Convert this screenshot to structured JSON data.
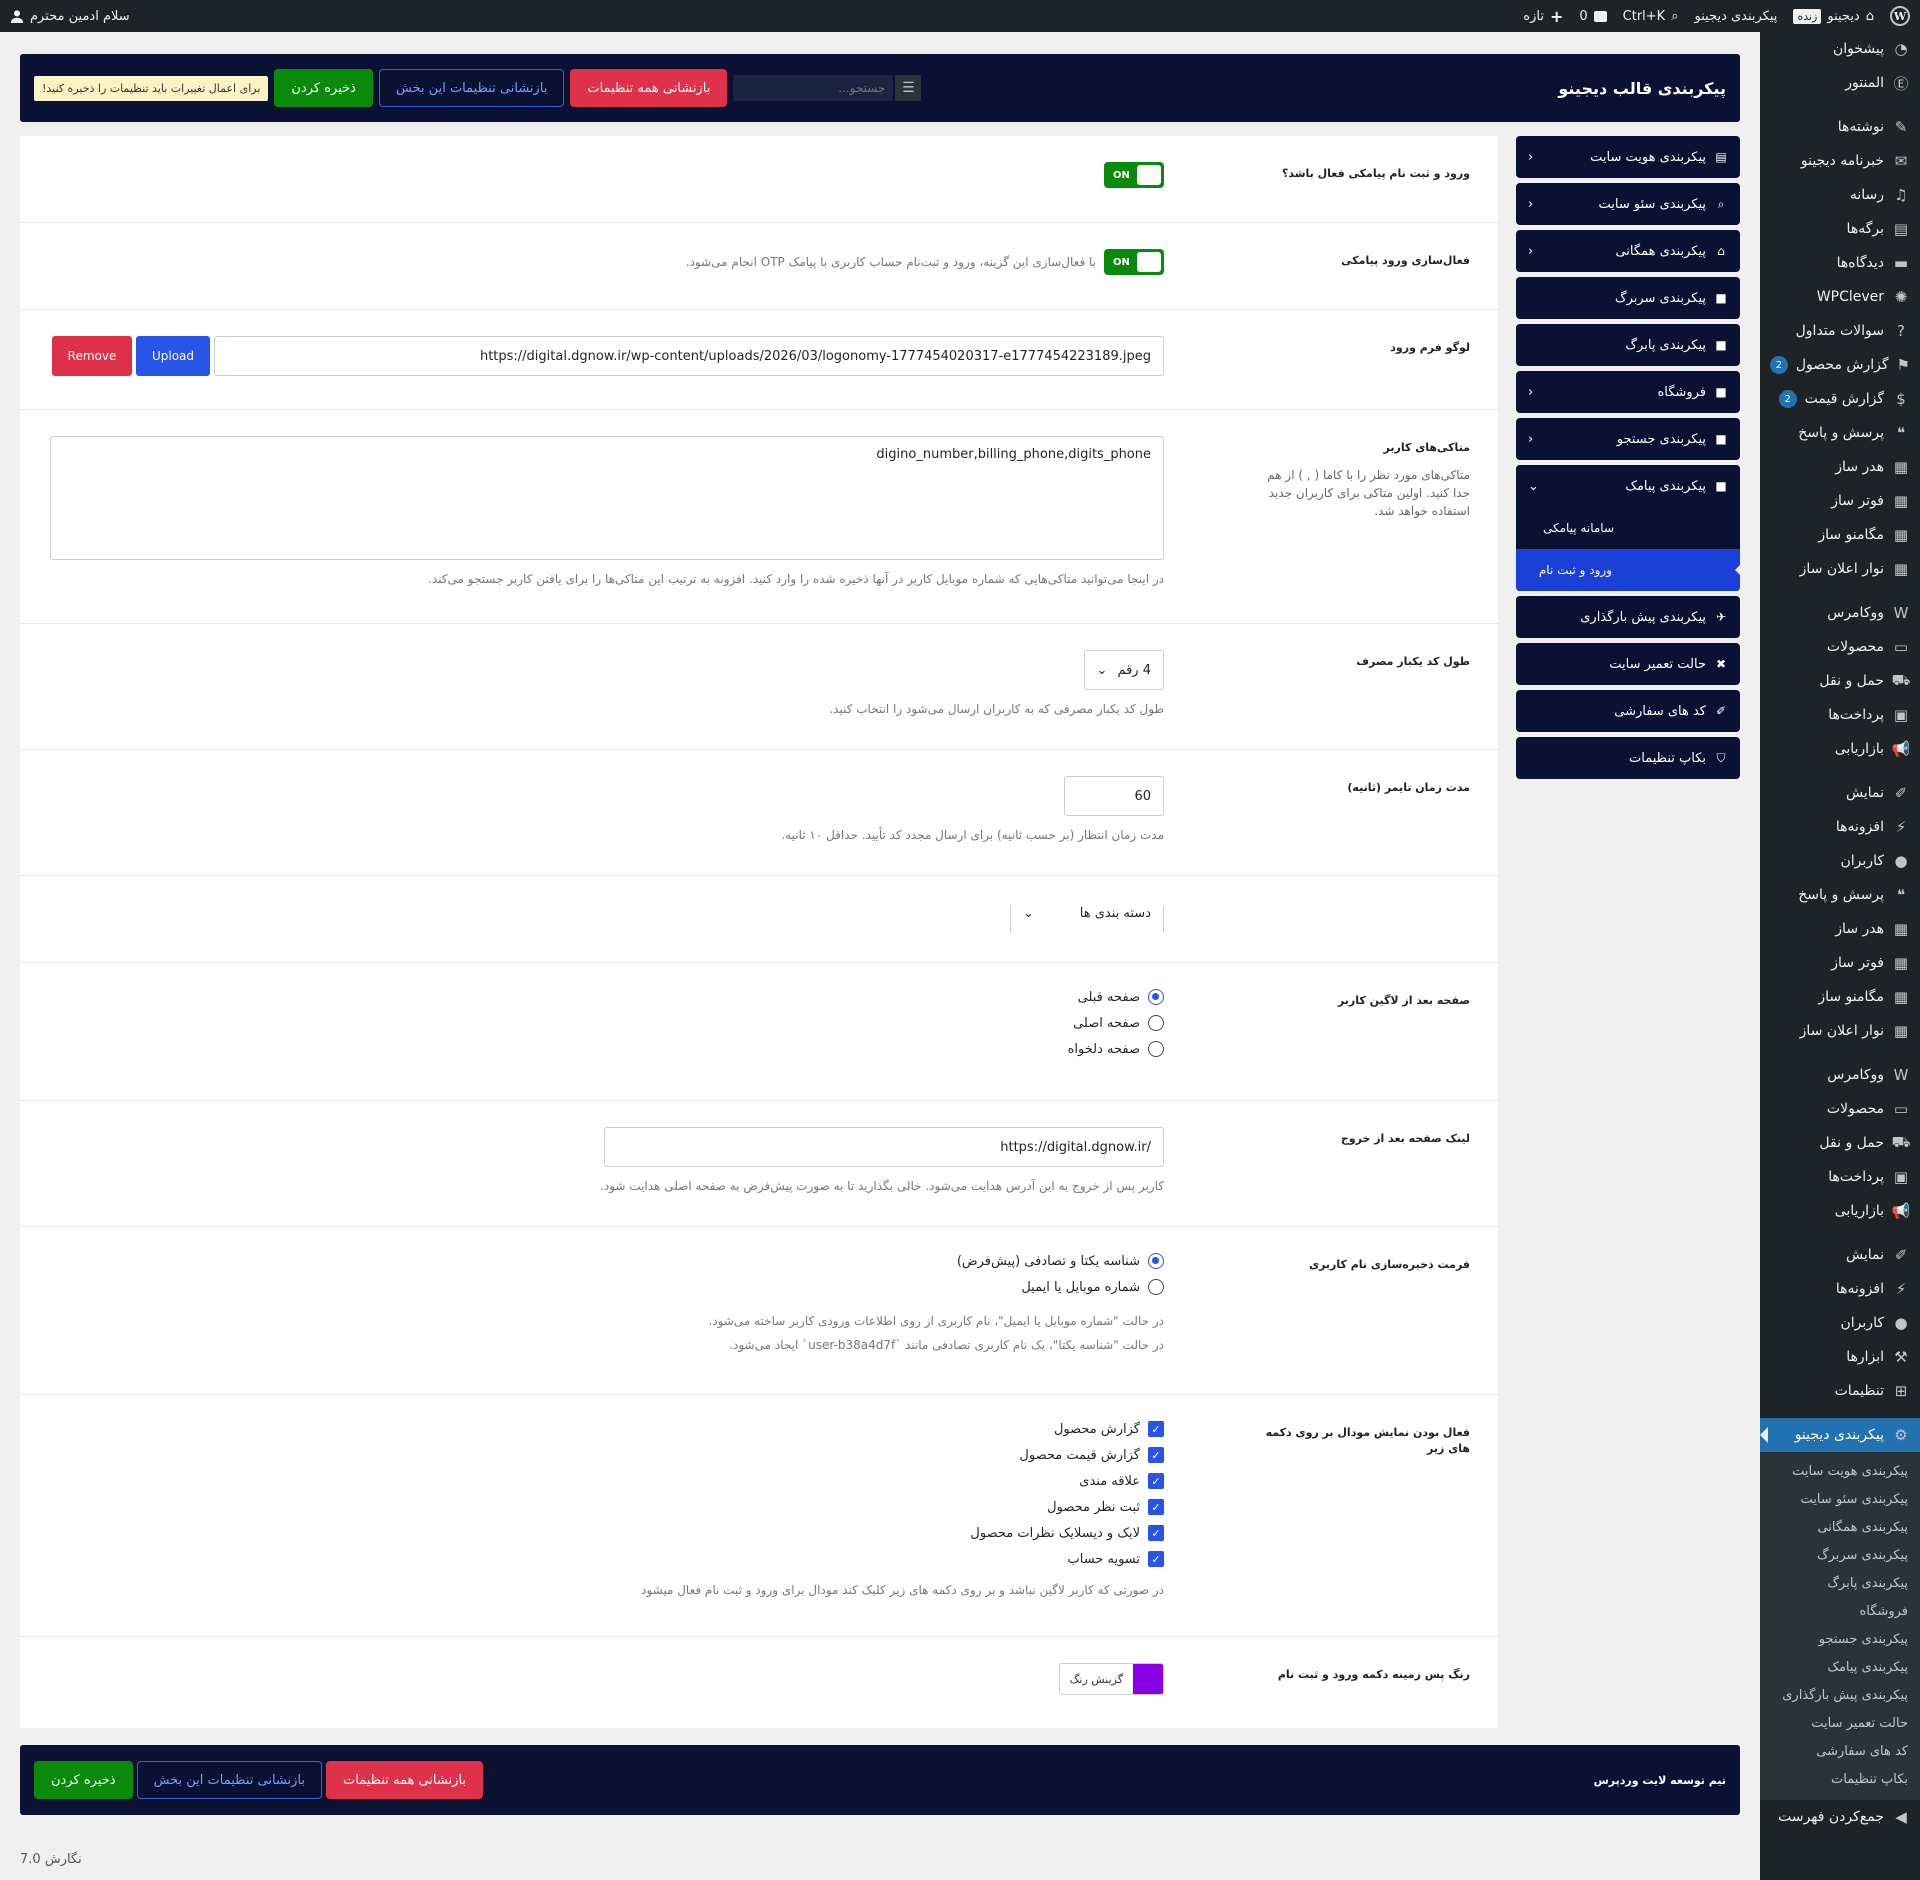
{
  "adminbar": {
    "site_name": "دیجینو",
    "live": "زنده",
    "theme_config": "پیکربندی دیجینو",
    "shortcut": "Ctrl+K",
    "comments_count": "0",
    "new_label": "تازه",
    "greeting": "سلام ادمین محترم"
  },
  "menu": {
    "items": [
      {
        "label": "پیشخوان",
        "icon": "dashboard-icon"
      },
      {
        "label": "المنتور",
        "icon": "elementor-icon"
      },
      {
        "label": "نوشته‌ها",
        "icon": "pin-icon"
      },
      {
        "label": "خبرنامه دیجینو",
        "icon": "mail-icon"
      },
      {
        "label": "رسانه",
        "icon": "media-icon"
      },
      {
        "label": "برگه‌ها",
        "icon": "pages-icon"
      },
      {
        "label": "دیدگاه‌ها",
        "icon": "comment-icon"
      },
      {
        "label": "WPClever",
        "icon": "bulb-icon"
      },
      {
        "label": "سوالات متداول",
        "icon": "help-icon"
      },
      {
        "label": "گزارش محصول",
        "icon": "flag-icon",
        "count": "2"
      },
      {
        "label": "گزارش قیمت",
        "icon": "dollar-icon",
        "count": "2"
      },
      {
        "label": "پرسش و پاسخ",
        "icon": "chat-icon"
      },
      {
        "label": "هدر ساز",
        "icon": "grid-icon"
      },
      {
        "label": "فوتر ساز",
        "icon": "grid-icon"
      },
      {
        "label": "مگامنو ساز",
        "icon": "grid-icon"
      },
      {
        "label": "نوار اعلان ساز",
        "icon": "grid-icon"
      },
      {
        "label": "ووکامرس",
        "icon": "woo-icon"
      },
      {
        "label": "محصولات",
        "icon": "archive-icon"
      },
      {
        "label": "حمل و نقل",
        "icon": "truck-icon"
      },
      {
        "label": "پرداخت‌ها",
        "icon": "payment-icon"
      },
      {
        "label": "بازاریابی",
        "icon": "megaphone-icon"
      },
      {
        "label": "نمایش",
        "icon": "brush-icon"
      },
      {
        "label": "افزونه‌ها",
        "icon": "plugin-icon"
      },
      {
        "label": "کاربران",
        "icon": "user-icon"
      },
      {
        "label": "پرسش و پاسخ",
        "icon": "chat-icon"
      },
      {
        "label": "هدر ساز",
        "icon": "grid-icon"
      },
      {
        "label": "فوتر ساز",
        "icon": "grid-icon"
      },
      {
        "label": "مگامنو ساز",
        "icon": "grid-icon"
      },
      {
        "label": "نوار اعلان ساز",
        "icon": "grid-icon"
      },
      {
        "label": "ووکامرس",
        "icon": "woo-icon"
      },
      {
        "label": "محصولات",
        "icon": "archive-icon"
      },
      {
        "label": "حمل و نقل",
        "icon": "truck-icon"
      },
      {
        "label": "پرداخت‌ها",
        "icon": "payment-icon"
      },
      {
        "label": "بازاریابی",
        "icon": "megaphone-icon"
      },
      {
        "label": "نمایش",
        "icon": "brush-icon"
      },
      {
        "label": "افزونه‌ها",
        "icon": "plugin-icon"
      },
      {
        "label": "کاربران",
        "icon": "user-icon"
      },
      {
        "label": "ابزارها",
        "icon": "wrench-icon"
      },
      {
        "label": "تنظیمات",
        "icon": "settings-icon"
      }
    ],
    "active": {
      "label": "پیکربندی دیجینو",
      "icon": "gear-icon"
    },
    "submenu": [
      "پیکربندی هویت سایت",
      "پیکربندی سئو سایت",
      "پیکربندی همگانی",
      "پیکربندی سربرگ",
      "پیکربندی پابرگ",
      "فروشگاه",
      "پیکربندی جستجو",
      "پیکربندی پیامک",
      "پیکربندی پیش بارگذاری",
      "حالت تعمیر سایت",
      "کد های سفارشی",
      "بکاپ تنظیمات"
    ],
    "collapse": "جمع‌کردن فهرست"
  },
  "topbar": {
    "title": "پیکربندی قالب دیجینو",
    "search_placeholder": "جستجو...",
    "reset_all": "بازنشانی همه تنظیمات",
    "reset_section": "بازنشانی تنظیمات این بخش",
    "save": "ذخیره کردن",
    "notice": "برای اعمال تغییرات باید تنظیمات را ذخیره کنید!"
  },
  "sidenav": {
    "items": [
      {
        "label": "پیکربندی هویت سایت",
        "icon": "id-card-icon",
        "chevron": true
      },
      {
        "label": "پیکربندی سئو سایت",
        "icon": "search-icon",
        "chevron": true
      },
      {
        "label": "پیکربندی همگانی",
        "icon": "home-icon",
        "chevron": true
      },
      {
        "label": "پیکربندی سربرگ",
        "icon": "lock-icon",
        "chevron": false
      },
      {
        "label": "پیکربندی پابرگ",
        "icon": "lock-icon",
        "chevron": false
      },
      {
        "label": "فروشگاه",
        "icon": "lock-icon",
        "chevron": true
      },
      {
        "label": "پیکربندی جستجو",
        "icon": "lock-icon",
        "chevron": true
      }
    ],
    "sms_group": {
      "label": "پیکربندی پیامک",
      "subs": [
        "سامانه پیامکی",
        "ورود و ثبت نام"
      ]
    },
    "after": [
      {
        "label": "پیکربندی پیش بارگذاری",
        "icon": "rocket-icon"
      },
      {
        "label": "حالت تعمیر سایت",
        "icon": "tools-icon"
      },
      {
        "label": "کد های سفارشی",
        "icon": "brush-icon"
      },
      {
        "label": "بکاپ تنظیمات",
        "icon": "shield-icon"
      }
    ]
  },
  "fields": {
    "sms_login": {
      "label": "ورود و ثبت نام پیامکی فعال باشد؟",
      "toggle": "ON"
    },
    "sms_activate": {
      "label": "فعال‌سازی ورود پیامکی",
      "toggle": "ON",
      "help": "با فعال‌سازی این گزینه، ورود و ثبت‌نام حساب کاربری با پیامک OTP انجام می‌شود."
    },
    "logo": {
      "label": "لوگو فرم ورود",
      "value": "https://digital.dgnow.ir/wp-content/uploads/2026/03/logonomy-1777454020317-e1777454223189.jpeg",
      "upload": "Upload",
      "remove": "Remove"
    },
    "user_meta": {
      "label": "متاکی‌های کاربر",
      "desc": "متاکی‌های مورد نظر را با کاما ( , ) از هم جدا کنید. اولین متاکی برای کاربران جدید استفاده خواهد شد.",
      "value": "digino_number,billing_phone,digits_phone",
      "help": "در اینجا می‌توانید متاکی‌هایی که شماره موبایل کاربر در آنها ذخیره شده را وارد کنید. افزونه به ترتیب این متاکی‌ها را برای یافتن کاربر جستجو می‌کند."
    },
    "otp_length": {
      "label": "طول کد یکبار مصرف",
      "value": "4 رقم",
      "help": "طول کد یکبار مصرفی که به کاربران ارسال می‌شود را انتخاب کنید."
    },
    "timer": {
      "label": "مدت زمان تایمر (ثانیه)",
      "value": "60",
      "help": "مدت زمان انتظار (بر حسب ثانیه) برای ارسال مجدد کد تأیید. حداقل ۱۰ ثانیه."
    },
    "category": {
      "value": "دسته بندی ها"
    },
    "after_login": {
      "label": "صفحه بعد از لاگین کاربر",
      "options": [
        "صفحه قبلی",
        "صفحه اصلی",
        "صفحه دلخواه"
      ],
      "selected": 0
    },
    "logout_link": {
      "label": "لینک صفحه بعد از خروج",
      "value": "https://digital.dgnow.ir/",
      "help": "کاربر پس از خروج به این آدرس هدایت می‌شود. خالی بگذارید تا به صورت پیش‌فرض به صفحه اصلی هدایت شود."
    },
    "username_format": {
      "label": "فرمت ذخیره‌سازی نام کاربری",
      "options": [
        "شناسه یکتا و تصادفی (پیش‌فرض)",
        "شماره موبایل یا ایمیل"
      ],
      "selected": 0,
      "help1": "در حالت \"شماره موبایل یا ایمیل\"، نام کاربری از روی اطلاعات ورودی کاربر ساخته می‌شود.",
      "help2": "در حالت \"شناسه یکتا\"، یک نام کاربری تصادفی مانند `user-b38a4d7f` ایجاد می‌شود."
    },
    "modal_buttons": {
      "label": "فعال بودن نمایش مودال بر روی دکمه های زیر",
      "options": [
        "گزارش محصول",
        "گزارش قیمت محصول",
        "علاقه مندی",
        "ثبت نظر محصول",
        "لایک و دیسلایک نظرات محصول",
        "تسویه حساب"
      ],
      "help": "در صورتی که کاربر لاگین نباشد و بر روی دکمه های زیر کلیک کند مودال برای ورود و ثبت نام فعال میشود"
    },
    "bg_color": {
      "label": "رنگ پس زمینه دکمه ورود و ثبت نام",
      "button": "گزینش رنگ",
      "color": "#8a00e6"
    }
  },
  "bottombar": {
    "credit": "تیم توسعه لایت وردپرس",
    "reset_all": "بازنشانی همه تنظیمات",
    "reset_section": "بازنشانی تنظیمات این بخش",
    "save": "ذخیره کردن"
  },
  "version": "نگارش 7.0"
}
